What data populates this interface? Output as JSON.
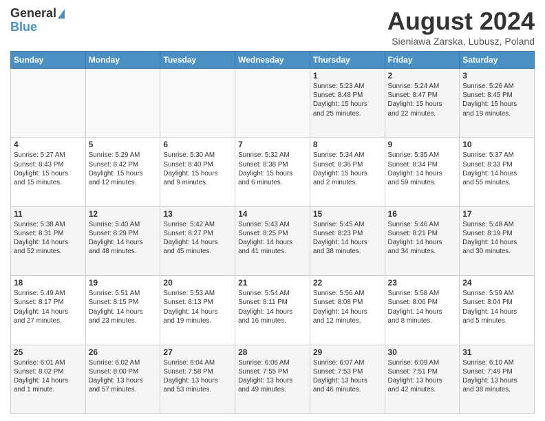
{
  "header": {
    "logo_line1": "General",
    "logo_line2": "Blue",
    "month_title": "August 2024",
    "location": "Sieniawa Zarska, Lubusz, Poland"
  },
  "days_of_week": [
    "Sunday",
    "Monday",
    "Tuesday",
    "Wednesday",
    "Thursday",
    "Friday",
    "Saturday"
  ],
  "weeks": [
    [
      {
        "day": "",
        "info": ""
      },
      {
        "day": "",
        "info": ""
      },
      {
        "day": "",
        "info": ""
      },
      {
        "day": "",
        "info": ""
      },
      {
        "day": "1",
        "info": "Sunrise: 5:23 AM\nSunset: 8:48 PM\nDaylight: 15 hours\nand 25 minutes."
      },
      {
        "day": "2",
        "info": "Sunrise: 5:24 AM\nSunset: 8:47 PM\nDaylight: 15 hours\nand 22 minutes."
      },
      {
        "day": "3",
        "info": "Sunrise: 5:26 AM\nSunset: 8:45 PM\nDaylight: 15 hours\nand 19 minutes."
      }
    ],
    [
      {
        "day": "4",
        "info": "Sunrise: 5:27 AM\nSunset: 8:43 PM\nDaylight: 15 hours\nand 15 minutes."
      },
      {
        "day": "5",
        "info": "Sunrise: 5:29 AM\nSunset: 8:42 PM\nDaylight: 15 hours\nand 12 minutes."
      },
      {
        "day": "6",
        "info": "Sunrise: 5:30 AM\nSunset: 8:40 PM\nDaylight: 15 hours\nand 9 minutes."
      },
      {
        "day": "7",
        "info": "Sunrise: 5:32 AM\nSunset: 8:38 PM\nDaylight: 15 hours\nand 6 minutes."
      },
      {
        "day": "8",
        "info": "Sunrise: 5:34 AM\nSunset: 8:36 PM\nDaylight: 15 hours\nand 2 minutes."
      },
      {
        "day": "9",
        "info": "Sunrise: 5:35 AM\nSunset: 8:34 PM\nDaylight: 14 hours\nand 59 minutes."
      },
      {
        "day": "10",
        "info": "Sunrise: 5:37 AM\nSunset: 8:33 PM\nDaylight: 14 hours\nand 55 minutes."
      }
    ],
    [
      {
        "day": "11",
        "info": "Sunrise: 5:38 AM\nSunset: 8:31 PM\nDaylight: 14 hours\nand 52 minutes."
      },
      {
        "day": "12",
        "info": "Sunrise: 5:40 AM\nSunset: 8:29 PM\nDaylight: 14 hours\nand 48 minutes."
      },
      {
        "day": "13",
        "info": "Sunrise: 5:42 AM\nSunset: 8:27 PM\nDaylight: 14 hours\nand 45 minutes."
      },
      {
        "day": "14",
        "info": "Sunrise: 5:43 AM\nSunset: 8:25 PM\nDaylight: 14 hours\nand 41 minutes."
      },
      {
        "day": "15",
        "info": "Sunrise: 5:45 AM\nSunset: 8:23 PM\nDaylight: 14 hours\nand 38 minutes."
      },
      {
        "day": "16",
        "info": "Sunrise: 5:46 AM\nSunset: 8:21 PM\nDaylight: 14 hours\nand 34 minutes."
      },
      {
        "day": "17",
        "info": "Sunrise: 5:48 AM\nSunset: 8:19 PM\nDaylight: 14 hours\nand 30 minutes."
      }
    ],
    [
      {
        "day": "18",
        "info": "Sunrise: 5:49 AM\nSunset: 8:17 PM\nDaylight: 14 hours\nand 27 minutes."
      },
      {
        "day": "19",
        "info": "Sunrise: 5:51 AM\nSunset: 8:15 PM\nDaylight: 14 hours\nand 23 minutes."
      },
      {
        "day": "20",
        "info": "Sunrise: 5:53 AM\nSunset: 8:13 PM\nDaylight: 14 hours\nand 19 minutes."
      },
      {
        "day": "21",
        "info": "Sunrise: 5:54 AM\nSunset: 8:11 PM\nDaylight: 14 hours\nand 16 minutes."
      },
      {
        "day": "22",
        "info": "Sunrise: 5:56 AM\nSunset: 8:08 PM\nDaylight: 14 hours\nand 12 minutes."
      },
      {
        "day": "23",
        "info": "Sunrise: 5:58 AM\nSunset: 8:06 PM\nDaylight: 14 hours\nand 8 minutes."
      },
      {
        "day": "24",
        "info": "Sunrise: 5:59 AM\nSunset: 8:04 PM\nDaylight: 14 hours\nand 5 minutes."
      }
    ],
    [
      {
        "day": "25",
        "info": "Sunrise: 6:01 AM\nSunset: 8:02 PM\nDaylight: 14 hours\nand 1 minute."
      },
      {
        "day": "26",
        "info": "Sunrise: 6:02 AM\nSunset: 8:00 PM\nDaylight: 13 hours\nand 57 minutes."
      },
      {
        "day": "27",
        "info": "Sunrise: 6:04 AM\nSunset: 7:58 PM\nDaylight: 13 hours\nand 53 minutes."
      },
      {
        "day": "28",
        "info": "Sunrise: 6:06 AM\nSunset: 7:55 PM\nDaylight: 13 hours\nand 49 minutes."
      },
      {
        "day": "29",
        "info": "Sunrise: 6:07 AM\nSunset: 7:53 PM\nDaylight: 13 hours\nand 46 minutes."
      },
      {
        "day": "30",
        "info": "Sunrise: 6:09 AM\nSunset: 7:51 PM\nDaylight: 13 hours\nand 42 minutes."
      },
      {
        "day": "31",
        "info": "Sunrise: 6:10 AM\nSunset: 7:49 PM\nDaylight: 13 hours\nand 38 minutes."
      }
    ]
  ]
}
